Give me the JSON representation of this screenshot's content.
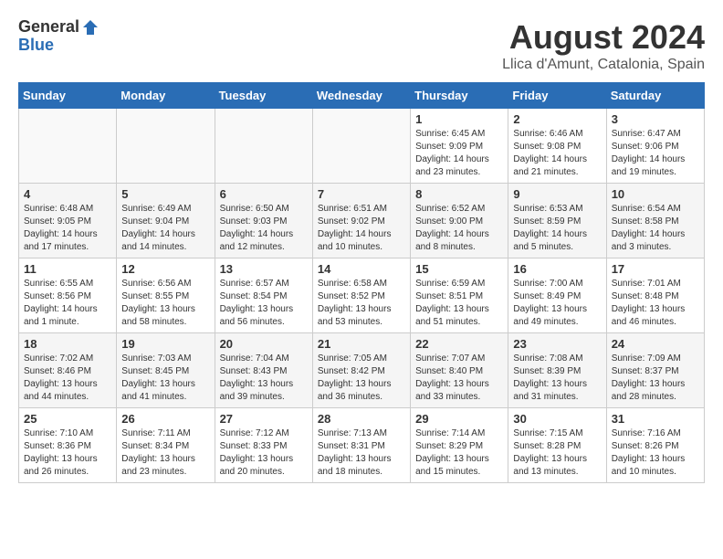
{
  "logo": {
    "general": "General",
    "blue": "Blue"
  },
  "title": "August 2024",
  "location": "Llica d'Amunt, Catalonia, Spain",
  "days_of_week": [
    "Sunday",
    "Monday",
    "Tuesday",
    "Wednesday",
    "Thursday",
    "Friday",
    "Saturday"
  ],
  "weeks": [
    [
      {
        "day": "",
        "info": ""
      },
      {
        "day": "",
        "info": ""
      },
      {
        "day": "",
        "info": ""
      },
      {
        "day": "",
        "info": ""
      },
      {
        "day": "1",
        "info": "Sunrise: 6:45 AM\nSunset: 9:09 PM\nDaylight: 14 hours\nand 23 minutes."
      },
      {
        "day": "2",
        "info": "Sunrise: 6:46 AM\nSunset: 9:08 PM\nDaylight: 14 hours\nand 21 minutes."
      },
      {
        "day": "3",
        "info": "Sunrise: 6:47 AM\nSunset: 9:06 PM\nDaylight: 14 hours\nand 19 minutes."
      }
    ],
    [
      {
        "day": "4",
        "info": "Sunrise: 6:48 AM\nSunset: 9:05 PM\nDaylight: 14 hours\nand 17 minutes."
      },
      {
        "day": "5",
        "info": "Sunrise: 6:49 AM\nSunset: 9:04 PM\nDaylight: 14 hours\nand 14 minutes."
      },
      {
        "day": "6",
        "info": "Sunrise: 6:50 AM\nSunset: 9:03 PM\nDaylight: 14 hours\nand 12 minutes."
      },
      {
        "day": "7",
        "info": "Sunrise: 6:51 AM\nSunset: 9:02 PM\nDaylight: 14 hours\nand 10 minutes."
      },
      {
        "day": "8",
        "info": "Sunrise: 6:52 AM\nSunset: 9:00 PM\nDaylight: 14 hours\nand 8 minutes."
      },
      {
        "day": "9",
        "info": "Sunrise: 6:53 AM\nSunset: 8:59 PM\nDaylight: 14 hours\nand 5 minutes."
      },
      {
        "day": "10",
        "info": "Sunrise: 6:54 AM\nSunset: 8:58 PM\nDaylight: 14 hours\nand 3 minutes."
      }
    ],
    [
      {
        "day": "11",
        "info": "Sunrise: 6:55 AM\nSunset: 8:56 PM\nDaylight: 14 hours\nand 1 minute."
      },
      {
        "day": "12",
        "info": "Sunrise: 6:56 AM\nSunset: 8:55 PM\nDaylight: 13 hours\nand 58 minutes."
      },
      {
        "day": "13",
        "info": "Sunrise: 6:57 AM\nSunset: 8:54 PM\nDaylight: 13 hours\nand 56 minutes."
      },
      {
        "day": "14",
        "info": "Sunrise: 6:58 AM\nSunset: 8:52 PM\nDaylight: 13 hours\nand 53 minutes."
      },
      {
        "day": "15",
        "info": "Sunrise: 6:59 AM\nSunset: 8:51 PM\nDaylight: 13 hours\nand 51 minutes."
      },
      {
        "day": "16",
        "info": "Sunrise: 7:00 AM\nSunset: 8:49 PM\nDaylight: 13 hours\nand 49 minutes."
      },
      {
        "day": "17",
        "info": "Sunrise: 7:01 AM\nSunset: 8:48 PM\nDaylight: 13 hours\nand 46 minutes."
      }
    ],
    [
      {
        "day": "18",
        "info": "Sunrise: 7:02 AM\nSunset: 8:46 PM\nDaylight: 13 hours\nand 44 minutes."
      },
      {
        "day": "19",
        "info": "Sunrise: 7:03 AM\nSunset: 8:45 PM\nDaylight: 13 hours\nand 41 minutes."
      },
      {
        "day": "20",
        "info": "Sunrise: 7:04 AM\nSunset: 8:43 PM\nDaylight: 13 hours\nand 39 minutes."
      },
      {
        "day": "21",
        "info": "Sunrise: 7:05 AM\nSunset: 8:42 PM\nDaylight: 13 hours\nand 36 minutes."
      },
      {
        "day": "22",
        "info": "Sunrise: 7:07 AM\nSunset: 8:40 PM\nDaylight: 13 hours\nand 33 minutes."
      },
      {
        "day": "23",
        "info": "Sunrise: 7:08 AM\nSunset: 8:39 PM\nDaylight: 13 hours\nand 31 minutes."
      },
      {
        "day": "24",
        "info": "Sunrise: 7:09 AM\nSunset: 8:37 PM\nDaylight: 13 hours\nand 28 minutes."
      }
    ],
    [
      {
        "day": "25",
        "info": "Sunrise: 7:10 AM\nSunset: 8:36 PM\nDaylight: 13 hours\nand 26 minutes."
      },
      {
        "day": "26",
        "info": "Sunrise: 7:11 AM\nSunset: 8:34 PM\nDaylight: 13 hours\nand 23 minutes."
      },
      {
        "day": "27",
        "info": "Sunrise: 7:12 AM\nSunset: 8:33 PM\nDaylight: 13 hours\nand 20 minutes."
      },
      {
        "day": "28",
        "info": "Sunrise: 7:13 AM\nSunset: 8:31 PM\nDaylight: 13 hours\nand 18 minutes."
      },
      {
        "day": "29",
        "info": "Sunrise: 7:14 AM\nSunset: 8:29 PM\nDaylight: 13 hours\nand 15 minutes."
      },
      {
        "day": "30",
        "info": "Sunrise: 7:15 AM\nSunset: 8:28 PM\nDaylight: 13 hours\nand 13 minutes."
      },
      {
        "day": "31",
        "info": "Sunrise: 7:16 AM\nSunset: 8:26 PM\nDaylight: 13 hours\nand 10 minutes."
      }
    ]
  ]
}
